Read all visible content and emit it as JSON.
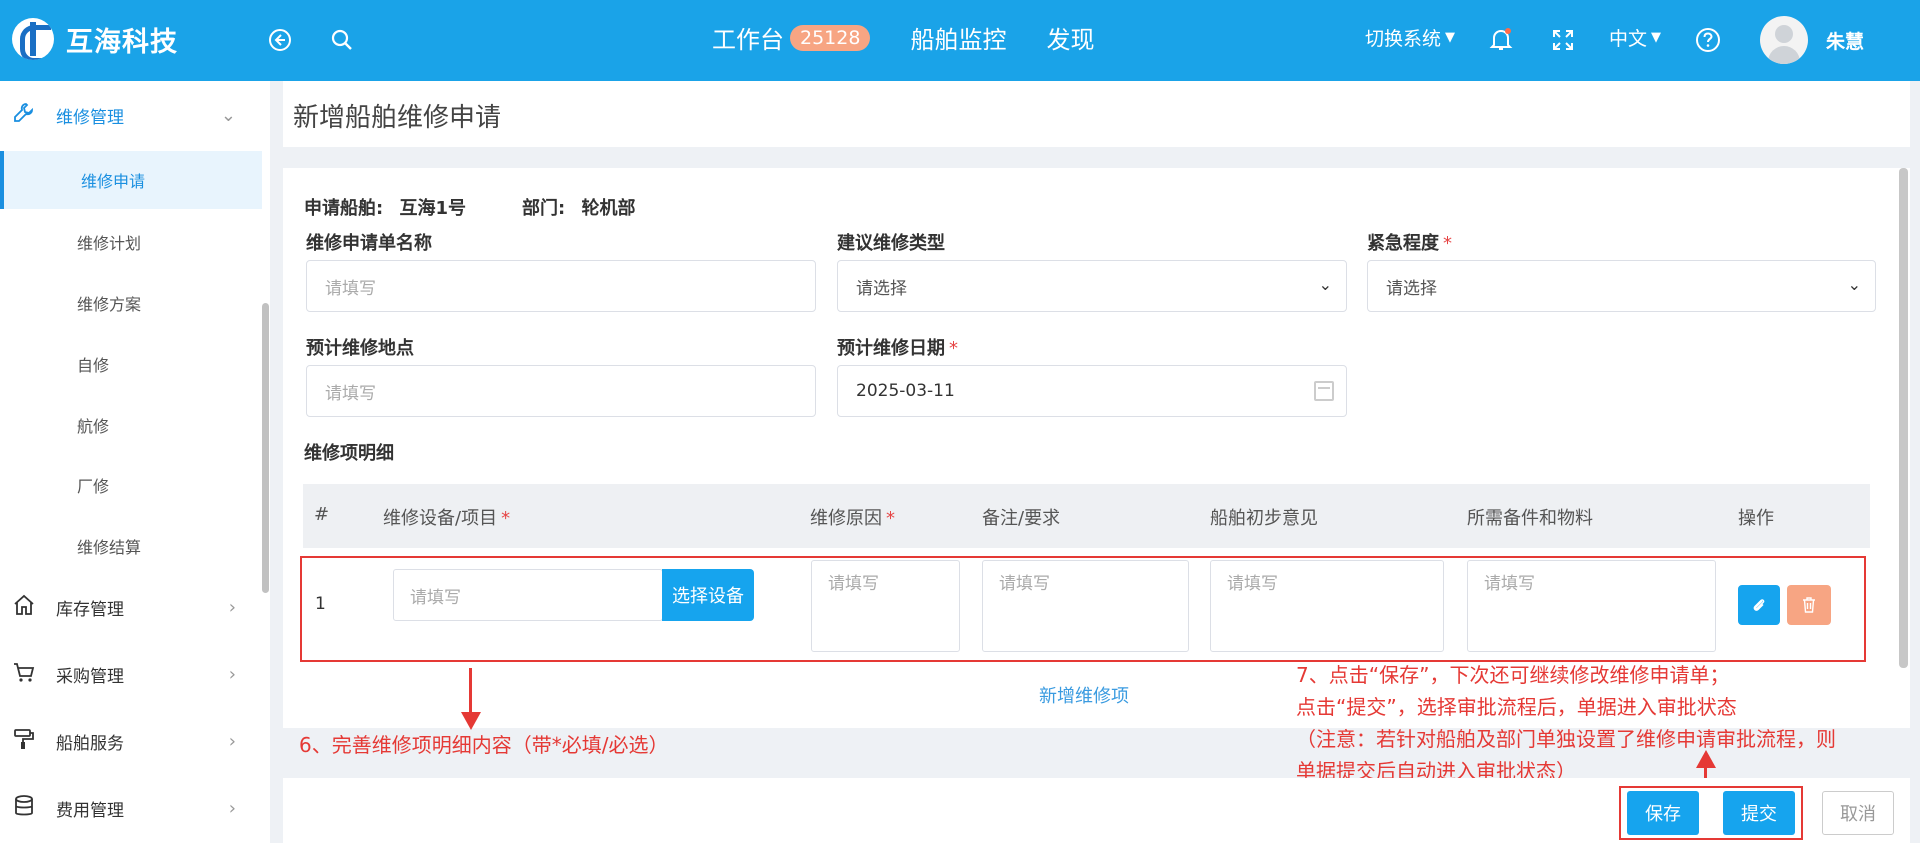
{
  "header": {
    "brand": "互海科技",
    "nav": [
      {
        "label": "工作台",
        "badge": "25128"
      },
      {
        "label": "船舶监控"
      },
      {
        "label": "发现"
      }
    ],
    "switch_system": "切换系统",
    "language": "中文",
    "username": "朱慧",
    "accent_color": "#1aa3e8"
  },
  "sidebar": {
    "section": "维修管理",
    "sub_items": [
      "维修申请",
      "维修计划",
      "维修方案",
      "自修",
      "航修",
      "厂修",
      "维修结算"
    ],
    "active_index": 0,
    "groups": [
      "库存管理",
      "采购管理",
      "船舶服务",
      "费用管理"
    ]
  },
  "page": {
    "title": "新增船舶维修申请",
    "ship_label": "申请船舶:",
    "ship_value": "互海1号",
    "dept_label": "部门:",
    "dept_value": "轮机部"
  },
  "form": {
    "name_label": "维修申请单名称",
    "name_placeholder": "请填写",
    "type_label": "建议维修类型",
    "type_placeholder": "请选择",
    "urgency_label": "紧急程度",
    "urgency_placeholder": "请选择",
    "place_label": "预计维修地点",
    "place_placeholder": "请填写",
    "date_label": "预计维修日期",
    "date_value": "2025-03-11",
    "required_mark": "*"
  },
  "detail": {
    "section_title": "维修项明细",
    "columns": [
      "#",
      "维修设备/项目",
      "维修原因",
      "备注/要求",
      "船舶初步意见",
      "所需备件和物料",
      "操作"
    ],
    "row": {
      "index": "1",
      "placeholder": "请填写",
      "choose_button": "选择设备"
    },
    "add_item": "新增维修项"
  },
  "annotations": {
    "step6": "6、完善维修项明细内容（带*必填/必选）",
    "step7_line1": "7、点击“保存”，下次还可继续修改维修申请单；",
    "step7_line2": "点击“提交”，选择审批流程后，单据进入审批状态",
    "step7_line3": "（注意：若针对船舶及部门单独设置了维修申请审批流程，则",
    "step7_line4": "单据提交后自动进入审批状态）"
  },
  "footer": {
    "save": "保存",
    "submit": "提交",
    "cancel": "取消"
  }
}
